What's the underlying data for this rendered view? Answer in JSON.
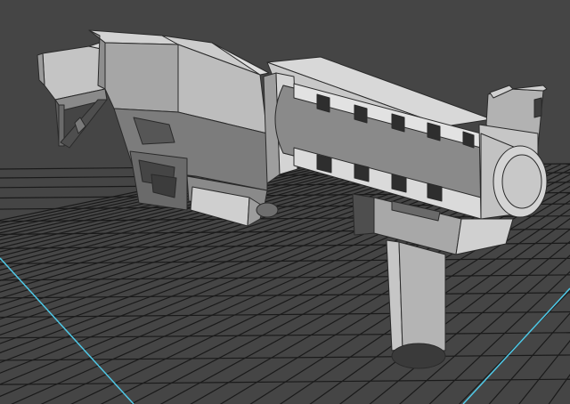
{
  "viewport": {
    "background_color": "#454545",
    "grid_color": "#1a1a1a",
    "axis_color": "#4fc8e6",
    "model_light_color": "#b8b8b8",
    "model_mid_color": "#8c8c8c",
    "model_dark_color": "#5a5a5a",
    "model_shadow_color": "#3a3a3a"
  },
  "scene": {
    "object": "rifle-model",
    "grid_visible": true,
    "shading": "flat"
  }
}
